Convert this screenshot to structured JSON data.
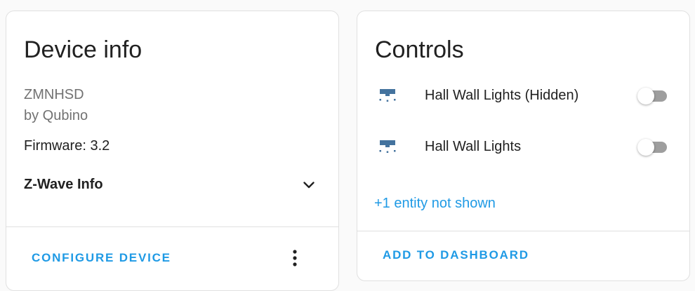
{
  "device_card": {
    "title": "Device info",
    "model": "ZMNHSD",
    "manufacturer": "by Qubino",
    "firmware_label": "Firmware:",
    "firmware_value": "3.2",
    "expansion_label": "Z-Wave Info",
    "expansion_icon": "chevron-down-icon",
    "action_label": "CONFIGURE DEVICE",
    "menu_icon": "more-vertical-icon"
  },
  "controls_card": {
    "title": "Controls",
    "entities": [
      {
        "name": "Hall Wall Lights (Hidden)",
        "icon": "wall-light-icon",
        "state": "off"
      },
      {
        "name": "Hall Wall Lights",
        "icon": "wall-light-icon",
        "state": "off"
      }
    ],
    "hidden_entities_label": "+1 entity not shown",
    "action_label": "ADD TO DASHBOARD"
  },
  "colors": {
    "accent": "#1f9ae5",
    "icon": "#44739e",
    "toggle_off_track": "#9e9e9e",
    "secondary_text": "#727272"
  }
}
